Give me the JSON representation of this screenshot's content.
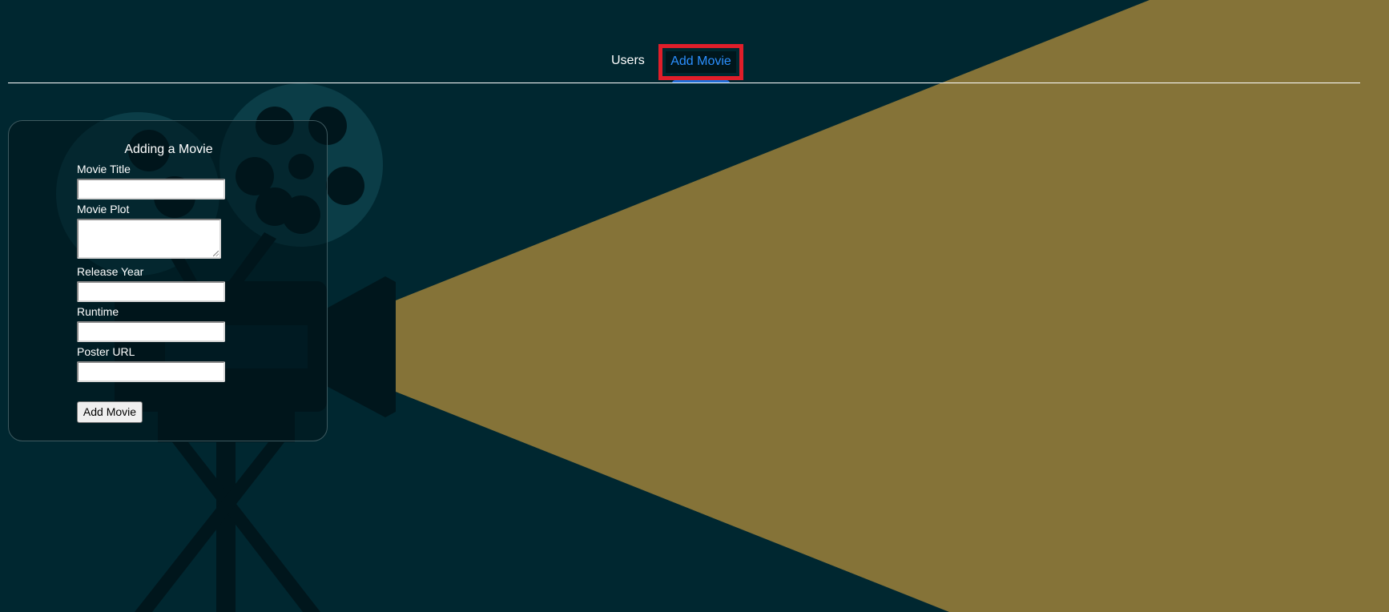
{
  "nav": {
    "users_label": "Users",
    "add_movie_label": "Add Movie",
    "active_tab": "Add Movie"
  },
  "form": {
    "title": "Adding a Movie",
    "fields": {
      "title": {
        "label": "Movie Title",
        "value": ""
      },
      "plot": {
        "label": "Movie Plot",
        "value": ""
      },
      "year": {
        "label": "Release Year",
        "value": ""
      },
      "runtime": {
        "label": "Runtime",
        "value": ""
      },
      "poster": {
        "label": "Poster URL",
        "value": ""
      }
    },
    "submit_label": "Add Movie"
  },
  "colors": {
    "background": "#002730",
    "projector_beam": "#857338",
    "projector_silhouette": "#00161c",
    "reel": "#0b3d47",
    "active_link": "#2b8fff",
    "highlight_border": "#e01e2a"
  },
  "icons": [
    "film-projector-icon",
    "film-reel-icon"
  ]
}
